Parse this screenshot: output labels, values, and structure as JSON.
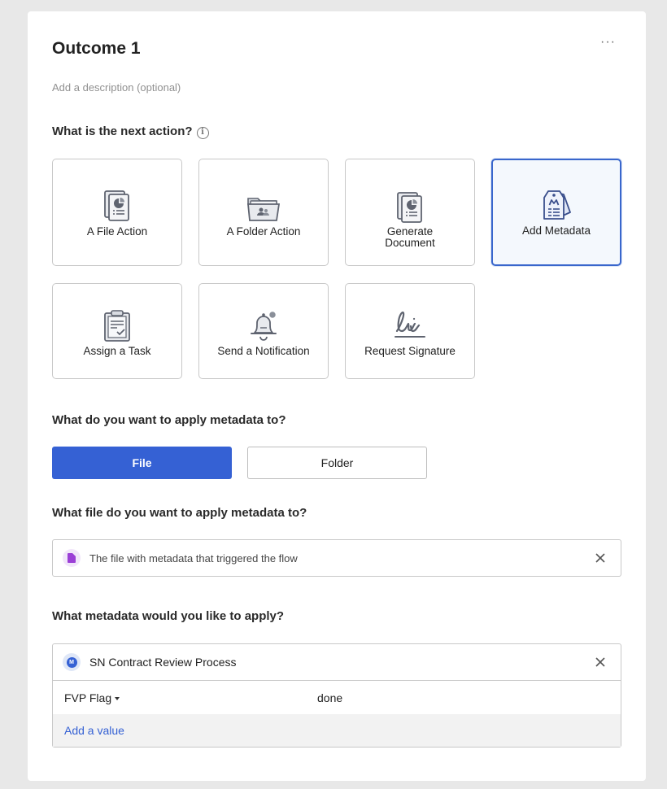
{
  "outcome": {
    "title": "Outcome 1",
    "description_placeholder": "Add a description (optional)",
    "more_label": "···"
  },
  "next_action": {
    "question": "What is the next action?",
    "info_glyph": "i",
    "selected": "add-metadata",
    "options": [
      {
        "id": "file-action",
        "label": "A File Action",
        "icon": "file-icon"
      },
      {
        "id": "folder-action",
        "label": "A Folder Action",
        "icon": "folder-icon"
      },
      {
        "id": "generate-document",
        "label": "Generate\nDocument",
        "icon": "document-icon"
      },
      {
        "id": "add-metadata",
        "label": "Add Metadata",
        "icon": "metadata-tag-icon"
      },
      {
        "id": "assign-task",
        "label": "Assign a Task",
        "icon": "clipboard-icon"
      },
      {
        "id": "send-notification",
        "label": "Send a Notification",
        "icon": "bell-icon"
      },
      {
        "id": "request-signature",
        "label": "Request Signature",
        "icon": "signature-icon"
      }
    ]
  },
  "apply_target": {
    "question": "What do you want to apply metadata to?",
    "file_label": "File",
    "folder_label": "Folder",
    "selected": "File"
  },
  "file_select": {
    "question": "What file do you want to apply metadata to?",
    "value": "The file with metadata that triggered the flow",
    "icon_color": "#9b3fd6"
  },
  "metadata": {
    "question": "What metadata would you like to apply?",
    "template": "SN Contract Review Process",
    "template_badge": "M",
    "fields": [
      {
        "key": "FVP Flag",
        "value": "done"
      }
    ],
    "add_value_label": "Add a value"
  },
  "colors": {
    "primary": "#3561d4",
    "selected_border": "#3966cc",
    "icon_gray": "#5f6470"
  }
}
